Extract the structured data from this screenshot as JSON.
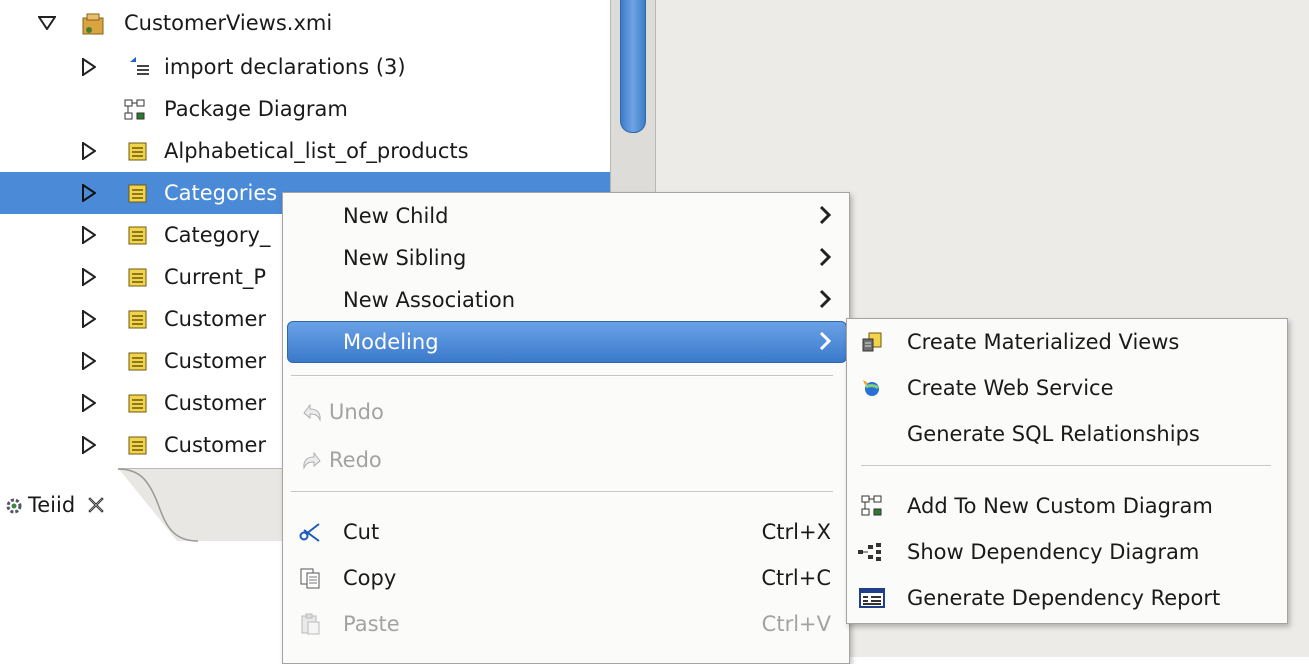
{
  "tree": {
    "root": {
      "label": "CustomerViews.xmi",
      "icon": "model-project-icon"
    },
    "items": [
      {
        "label": "import declarations (3)",
        "icon": "import-declarations-icon",
        "expandable": true
      },
      {
        "label": "Package Diagram",
        "icon": "package-diagram-icon",
        "expandable": false
      },
      {
        "label": "Alphabetical_list_of_products",
        "icon": "view-table-icon",
        "expandable": true
      },
      {
        "label": "Categories",
        "icon": "view-table-icon",
        "expandable": true,
        "selected": true
      },
      {
        "label": "Category_",
        "icon": "view-table-icon",
        "expandable": true
      },
      {
        "label": "Current_P",
        "icon": "view-table-icon",
        "expandable": true
      },
      {
        "label": "Customer",
        "icon": "view-table-icon",
        "expandable": true
      },
      {
        "label": "Customer",
        "icon": "view-table-icon",
        "expandable": true
      },
      {
        "label": "Customer",
        "icon": "view-table-icon",
        "expandable": true
      },
      {
        "label": "Customer",
        "icon": "view-table-icon",
        "expandable": true
      }
    ]
  },
  "bottom_tab": {
    "label": "Teiid",
    "icon": "teiid-gear-icon",
    "close_icon": "close-icon"
  },
  "context_menu": {
    "items": [
      {
        "label": "New Child",
        "submenu": true
      },
      {
        "label": "New Sibling",
        "submenu": true
      },
      {
        "label": "New Association",
        "submenu": true
      },
      {
        "label": "Modeling",
        "submenu": true,
        "highlighted": true
      },
      {
        "label": "Undo",
        "icon": "undo-icon",
        "disabled": true
      },
      {
        "label": "Redo",
        "icon": "redo-icon",
        "disabled": true
      },
      {
        "label": "Cut",
        "icon": "cut-icon",
        "accel": "Ctrl+X"
      },
      {
        "label": "Copy",
        "icon": "copy-icon",
        "accel": "Ctrl+C"
      },
      {
        "label": "Paste",
        "icon": "paste-icon",
        "accel": "Ctrl+V",
        "disabled": true
      }
    ]
  },
  "submenu": {
    "items": [
      {
        "label": "Create Materialized Views",
        "icon": "materialized-views-icon"
      },
      {
        "label": "Create Web Service",
        "icon": "web-service-icon"
      },
      {
        "label": "Generate SQL Relationships",
        "icon": ""
      },
      {
        "label": "Add To New Custom Diagram",
        "icon": "custom-diagram-icon"
      },
      {
        "label": "Show Dependency Diagram",
        "icon": "dependency-diagram-icon"
      },
      {
        "label": "Generate Dependency Report",
        "icon": "dependency-report-icon"
      }
    ]
  },
  "colors": {
    "selection": "#4a8ad6",
    "menu_highlight": "#3b79cb",
    "disabled_text": "#a3a3a3"
  }
}
